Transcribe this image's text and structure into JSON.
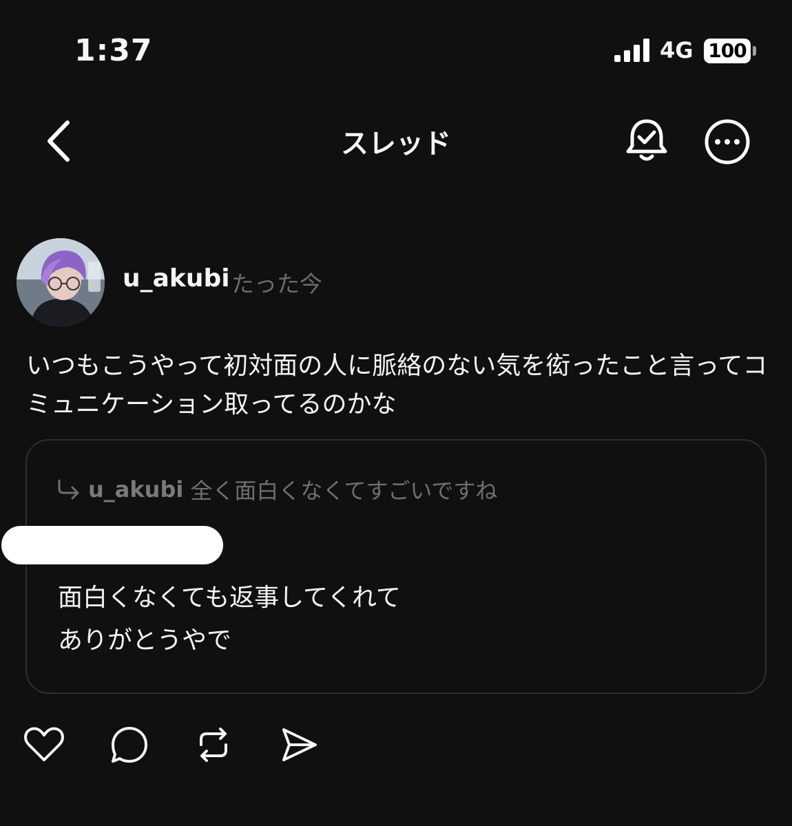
{
  "status_bar": {
    "time": "1:37",
    "network": "4G",
    "battery": "100"
  },
  "header": {
    "title": "スレッド"
  },
  "post": {
    "username": "u_akubi",
    "timestamp": "たった今",
    "text_line1": "いつもこうやって初対面の人に脈絡のない気を衒ったこと言ってコ",
    "text_line2": "ミュニケーション取ってるのかな"
  },
  "quoted": {
    "reply_user": "u_akubi",
    "reply_text": "全く面白くなくてすごいですね",
    "text_line1": "面白くなくても返事してくれて",
    "text_line2": "ありがとうやで"
  },
  "actions": {
    "like_icon": "heart-icon",
    "comment_icon": "comment-icon",
    "repost_icon": "repost-icon",
    "share_icon": "send-icon"
  },
  "colors": {
    "background": "#101010",
    "text": "#f3f5f7",
    "muted": "#6b6b6b",
    "card_border": "#2f2f2f"
  }
}
